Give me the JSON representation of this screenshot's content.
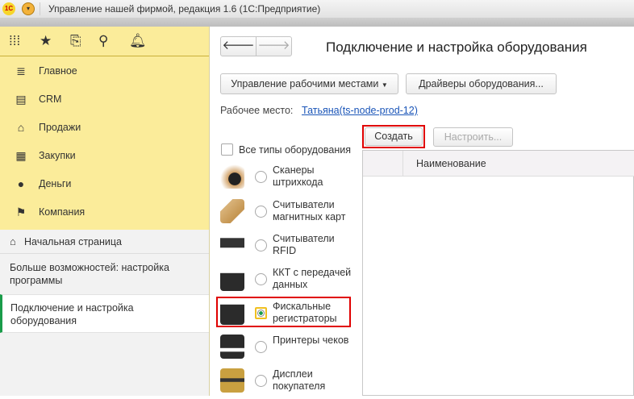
{
  "window": {
    "title": "Управление нашей фирмой, редакция 1.6  (1С:Предприятие)",
    "logo_text": "1С"
  },
  "sidebar": {
    "items": [
      {
        "label": "Главное",
        "icon": "list-icon"
      },
      {
        "label": "CRM",
        "icon": "contact-card-icon"
      },
      {
        "label": "Продажи",
        "icon": "basket-icon"
      },
      {
        "label": "Закупки",
        "icon": "cart-icon"
      },
      {
        "label": "Деньги",
        "icon": "coin-icon"
      },
      {
        "label": "Компания",
        "icon": "flag-icon"
      }
    ],
    "home": "Начальная страница",
    "open": [
      {
        "label": "Больше возможностей: настройка программы"
      },
      {
        "label": "Подключение и настройка оборудования",
        "active": true
      }
    ]
  },
  "main": {
    "title": "Подключение и настройка оборудования",
    "workplaces_button": "Управление рабочими местами",
    "drivers_button": "Драйверы оборудования...",
    "workplace_label": "Рабочее место:",
    "workplace_value": "Татьяна(ts-node-prod-12)",
    "all_types": "Все типы оборудования",
    "all_types_checked": false,
    "types": [
      {
        "label": "Сканеры штрихкода",
        "selected": false
      },
      {
        "label": "Считыватели магнитных карт",
        "selected": false
      },
      {
        "label": "Считыватели RFID",
        "selected": false
      },
      {
        "label": "ККТ с передачей данных",
        "selected": false
      },
      {
        "label": "Фискальные регистраторы",
        "selected": true
      },
      {
        "label": "Принтеры чеков",
        "selected": false
      },
      {
        "label": "Дисплеи покупателя",
        "selected": false
      }
    ],
    "create_button": "Создать",
    "configure_button": "Настроить...",
    "table": {
      "columns": [
        "",
        "Наименование"
      ],
      "rows": []
    }
  },
  "colors": {
    "sidebar": "#fbec9a",
    "highlight": "#e00000",
    "link": "#1a55b8",
    "active": "#1a9c4a"
  }
}
